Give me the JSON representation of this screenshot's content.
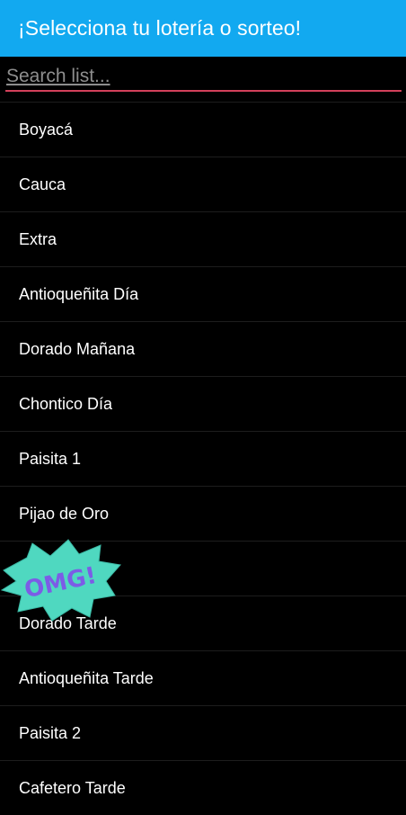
{
  "header": {
    "title": "¡Selecciona tu lotería o sorteo!"
  },
  "search": {
    "placeholder": "Search list...",
    "value": ""
  },
  "list": {
    "items": [
      {
        "label": "Boyacá"
      },
      {
        "label": "Cauca"
      },
      {
        "label": "Extra"
      },
      {
        "label": "Antioqueñita Día"
      },
      {
        "label": "Dorado Mañana"
      },
      {
        "label": "Chontico Día"
      },
      {
        "label": "Paisita 1"
      },
      {
        "label": "Pijao de Oro"
      },
      {
        "label": ""
      },
      {
        "label": "Dorado Tarde"
      },
      {
        "label": "Antioqueñita Tarde"
      },
      {
        "label": "Paisita 2"
      },
      {
        "label": "Cafetero Tarde"
      }
    ]
  },
  "sticker": {
    "text": "OMG!",
    "fill": "#4fd8c0",
    "text_color": "#7c5ce6"
  },
  "colors": {
    "appbar": "#12a9f0",
    "underline": "#d3405a",
    "background": "#000000"
  }
}
